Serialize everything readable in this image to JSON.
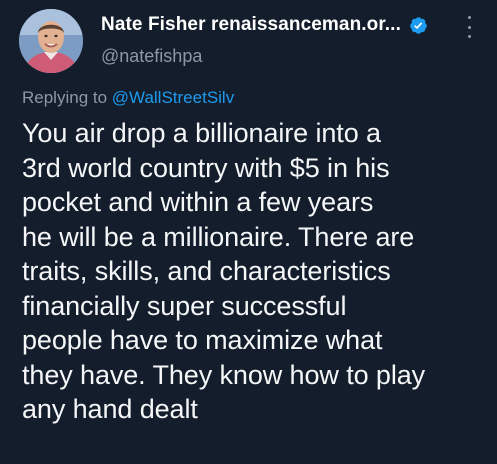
{
  "tweet": {
    "author": {
      "display_name": "Nate Fisher renaissanceman.or...",
      "handle": "@natefishpa",
      "verified": true
    },
    "reply": {
      "prefix": "Replying to ",
      "mention": "@WallStreetSilv"
    },
    "text": "You air drop a billionaire into a\n3rd world country with $5 in his\npocket and within a few years\nhe will be a millionaire. There are\ntraits, skills, and characteristics\nfinancially super successful\npeople have to maximize what\nthey have. They know how to play\nany hand dealt"
  },
  "colors": {
    "background": "#141d2b",
    "secondary_text": "#8b98a5",
    "accent": "#1d9bf0"
  }
}
